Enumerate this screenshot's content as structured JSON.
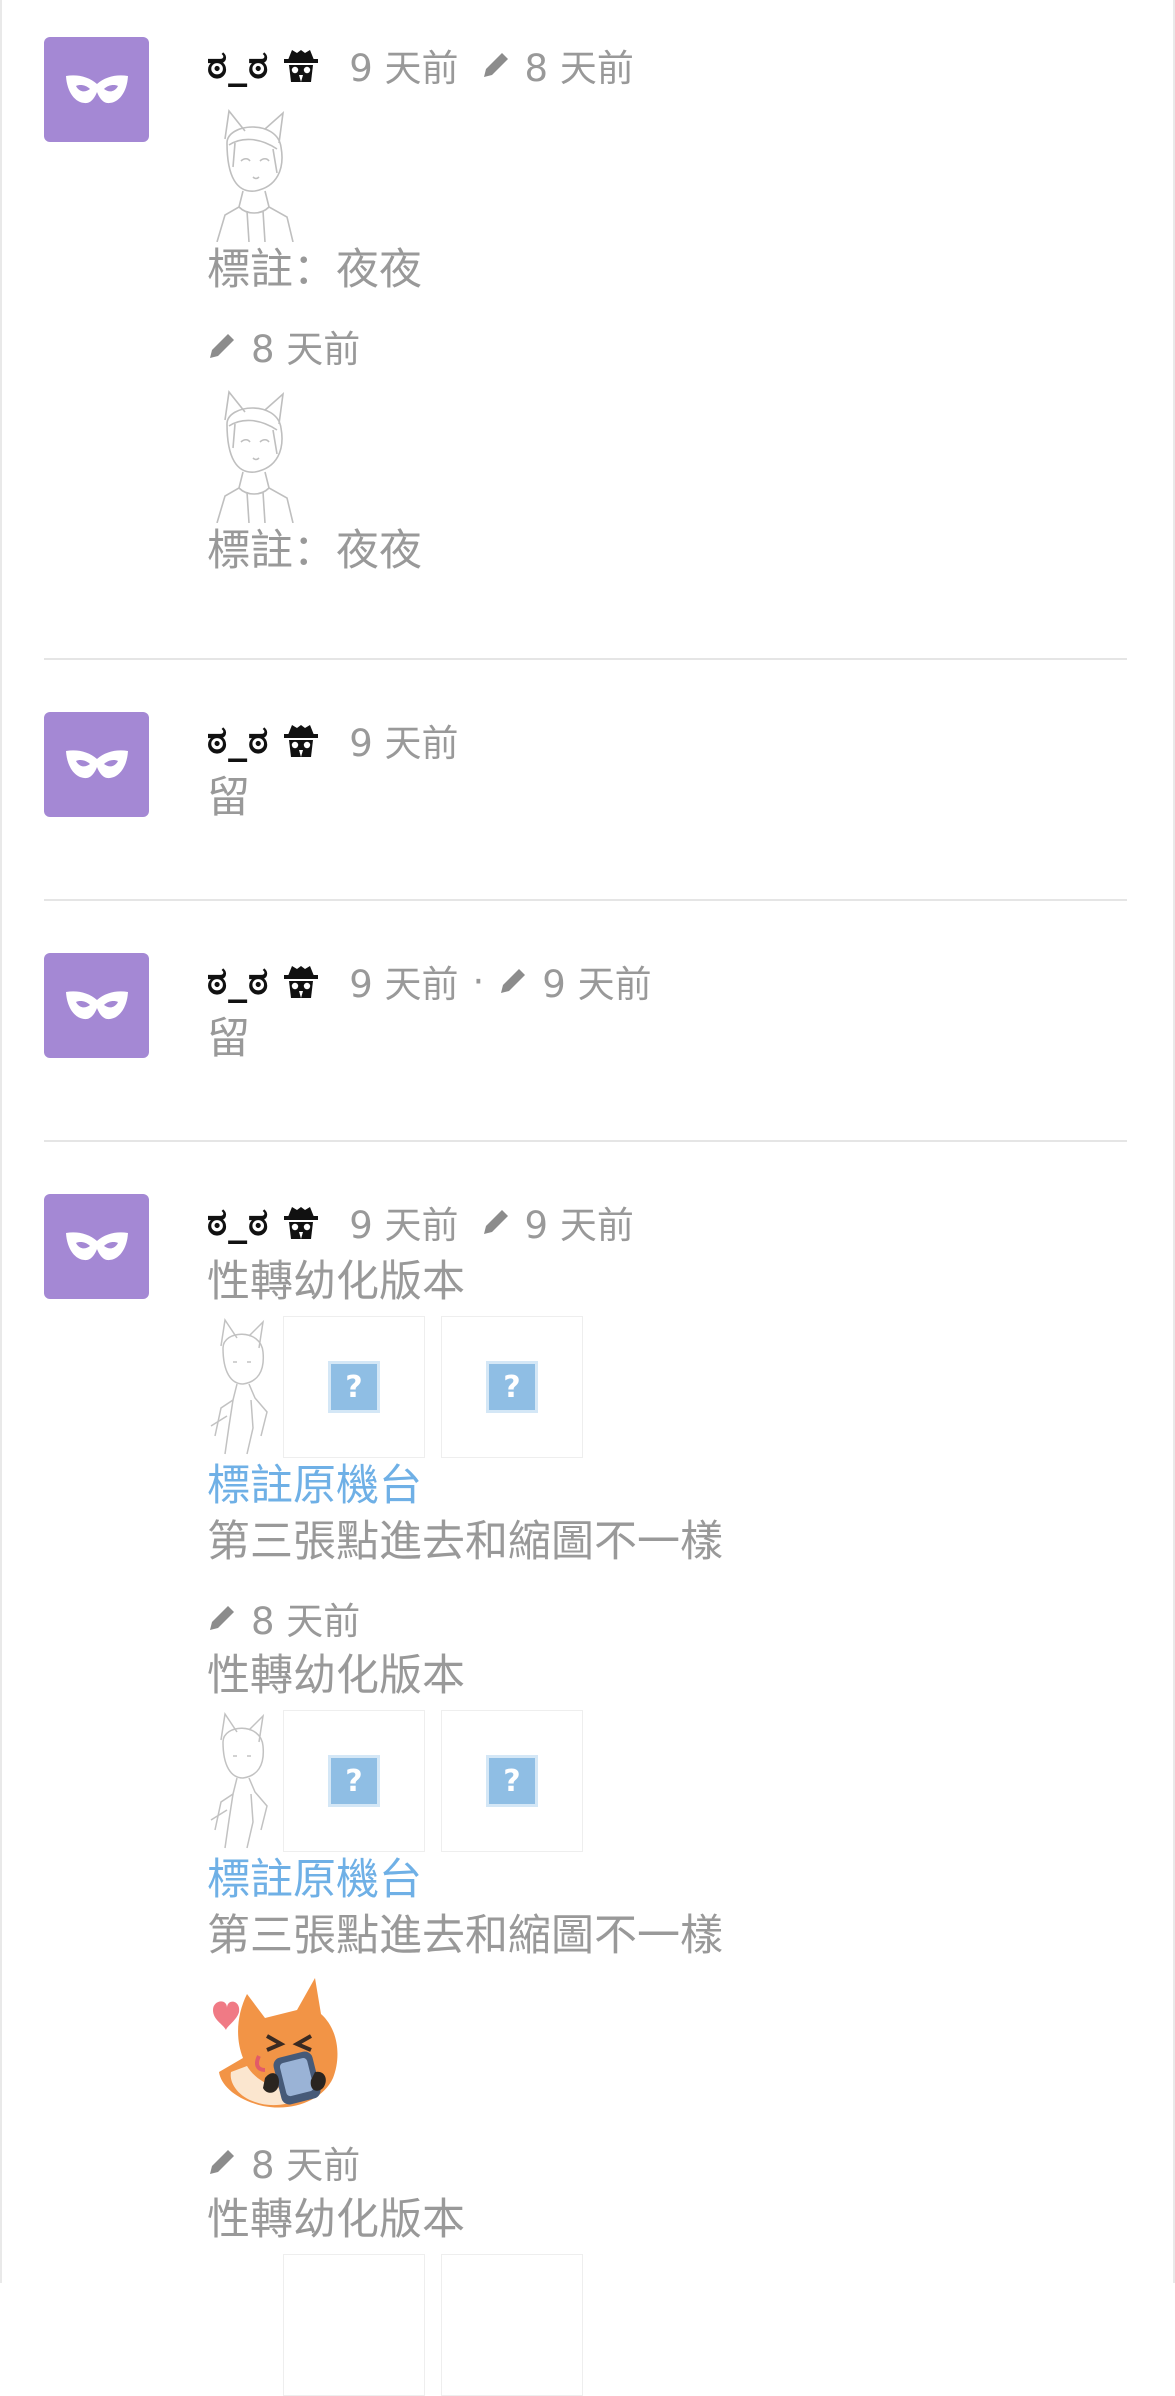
{
  "accent": "#a488d4",
  "link_color": "#6fb0e6",
  "comments": [
    {
      "user": "ಠ_ಠ",
      "time": "9 天前",
      "edit_time": "8 天前",
      "tag_text": "標註：夜夜",
      "revision": {
        "edit_time": "8 天前",
        "tag_text": "標註：夜夜"
      }
    },
    {
      "user": "ಠ_ಠ",
      "time": "9 天前",
      "text": "留"
    },
    {
      "user": "ಠ_ಠ",
      "time": "9 天前",
      "separator": "·",
      "edit_time": "9 天前",
      "text": "留"
    },
    {
      "user": "ಠ_ಠ",
      "time": "9 天前",
      "edit_time": "9 天前",
      "title": "性轉幼化版本",
      "link": "標註原機台",
      "note": "第三張點進去和縮圖不一樣",
      "placeholder_icon": "?",
      "revisions": [
        {
          "edit_time": "8 天前",
          "title": "性轉幼化版本",
          "link": "標註原機台",
          "note": "第三張點進去和縮圖不一樣"
        },
        {
          "edit_time": "8 天前",
          "title": "性轉幼化版本"
        }
      ]
    }
  ]
}
